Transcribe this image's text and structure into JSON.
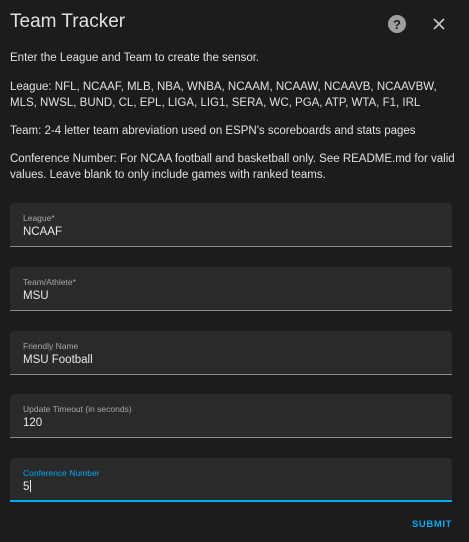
{
  "dialog": {
    "title": "Team Tracker",
    "help_icon": "help-circle-icon",
    "close_icon": "close-icon"
  },
  "description": {
    "intro": "Enter the League and Team to create the sensor.",
    "leagues": "League: NFL, NCAAF, MLB, NBA, WNBA, NCAAM, NCAAW, NCAAVB, NCAAVBW, MLS, NWSL, BUND, CL, EPL, LIGA, LIG1, SERA, WC, PGA, ATP, WTA, F1, IRL",
    "team": "Team: 2-4 letter team abreviation used on ESPN's scoreboards and stats pages",
    "conference": "Conference Number: For NCAA football and basketball only. See README.md for valid values. Leave blank to only include games with ranked teams."
  },
  "form": {
    "league": {
      "label": "League*",
      "value": "NCAAF"
    },
    "team": {
      "label": "Team/Athlete*",
      "value": "MSU"
    },
    "friendly_name": {
      "label": "Friendly Name",
      "value": "MSU Football"
    },
    "timeout": {
      "label": "Update Timeout (in seconds)",
      "value": "120"
    },
    "conference": {
      "label": "Conference Number",
      "value": "5"
    }
  },
  "actions": {
    "submit_label": "SUBMIT"
  },
  "colors": {
    "accent": "#03a9f4",
    "background": "#1c1c1c",
    "field_background": "#2a2a2a"
  }
}
